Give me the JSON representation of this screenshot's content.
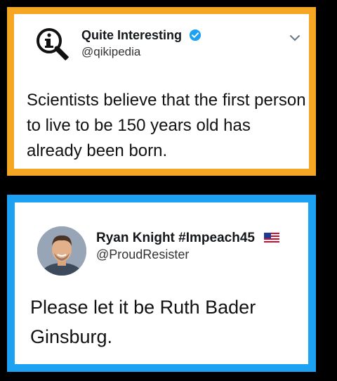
{
  "tweet1": {
    "display_name": "Quite Interesting",
    "handle": "@qikipedia",
    "verified": true,
    "text": "Scientists believe that the first person to live to be 150 years old has already been born.",
    "border_color": "#f5a623"
  },
  "tweet2": {
    "display_name": "Ryan Knight #Impeach45",
    "handle": "@ProudResister",
    "text": "Please let it be Ruth Bader Ginsburg.",
    "border_color": "#1da1f2"
  },
  "icons": [
    "qi-logo-icon",
    "verified-badge-icon",
    "chevron-down-icon",
    "us-flag-icon"
  ]
}
